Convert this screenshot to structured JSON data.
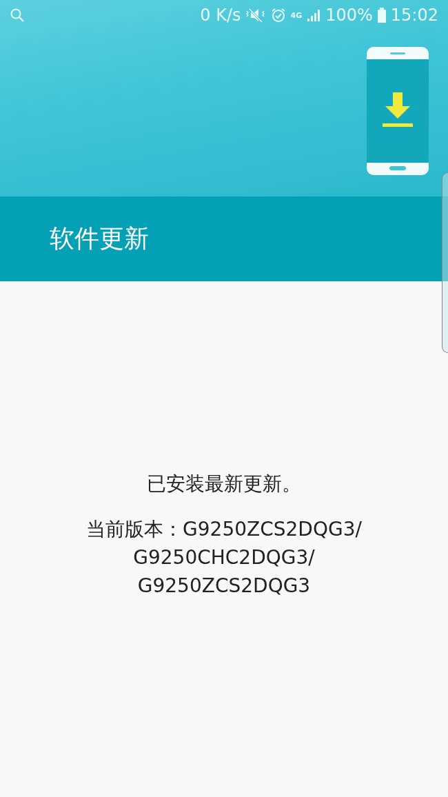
{
  "status_bar": {
    "speed": "0 K/s",
    "network": "4G",
    "battery": "100%",
    "time": "15:02"
  },
  "header": {
    "title": "软件更新"
  },
  "message": {
    "status": "已安装最新更新。",
    "version_lines": [
      "当前版本：G9250ZCS2DQG3/",
      "G9250CHC2DQG3/",
      "G9250ZCS2DQG3"
    ]
  }
}
